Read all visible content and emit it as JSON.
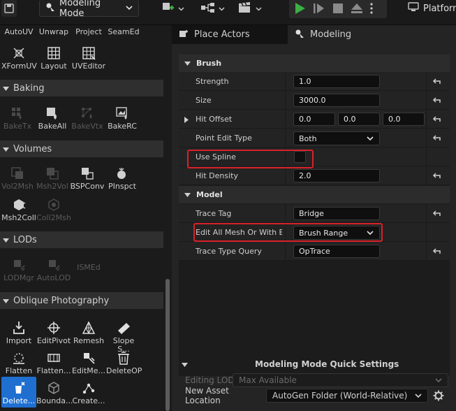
{
  "toolbar": {
    "mode_label": "Modeling Mode",
    "platform_label": "Platforms",
    "colors": {
      "play": "#3cb043",
      "bg": "#1a1a1a"
    }
  },
  "palette": {
    "top_tools": [
      {
        "label": "AutoUV",
        "icon": "auto-uv-icon",
        "enabled": true
      },
      {
        "label": "Unwrap",
        "icon": "unwrap-icon",
        "enabled": true
      },
      {
        "label": "Project",
        "icon": "project-icon",
        "enabled": true
      },
      {
        "label": "SeamEd",
        "icon": "seam-edit-icon",
        "enabled": true
      },
      {
        "label": "XFormUV",
        "icon": "transform-uv-icon",
        "enabled": true
      },
      {
        "label": "Layout",
        "icon": "layout-icon",
        "enabled": true
      },
      {
        "label": "UVEditor",
        "icon": "uv-editor-icon",
        "enabled": true
      }
    ],
    "sections": [
      {
        "title": "Baking",
        "tools": [
          {
            "label": "BakeTx",
            "enabled": false
          },
          {
            "label": "BakeAll",
            "enabled": true
          },
          {
            "label": "BakeVtx",
            "enabled": false
          },
          {
            "label": "BakeRC",
            "enabled": true
          }
        ]
      },
      {
        "title": "Volumes",
        "tools": [
          {
            "label": "Vol2Msh",
            "enabled": false
          },
          {
            "label": "Msh2Vol",
            "enabled": false
          },
          {
            "label": "BSPConv",
            "enabled": true
          },
          {
            "label": "PInspct",
            "enabled": true
          },
          {
            "label": "Msh2Coll",
            "enabled": true
          },
          {
            "label": "Coll2Msh",
            "enabled": false
          }
        ]
      },
      {
        "title": "LODs",
        "tools": [
          {
            "label": "LODMgr",
            "enabled": false
          },
          {
            "label": "AutoLOD",
            "enabled": false
          },
          {
            "label": "ISMEd",
            "enabled": false
          }
        ]
      },
      {
        "title": "Oblique Photography",
        "tools": [
          {
            "label": "Import",
            "enabled": true
          },
          {
            "label": "EditPivot",
            "enabled": true
          },
          {
            "label": "Remesh",
            "enabled": true
          },
          {
            "label": "Slope S...",
            "enabled": true
          },
          {
            "label": "Flatten",
            "enabled": true
          },
          {
            "label": "Flatten...",
            "enabled": true
          },
          {
            "label": "EditMe...",
            "enabled": true
          },
          {
            "label": "DeleteOP",
            "enabled": true
          },
          {
            "label": "Delete...",
            "enabled": true,
            "selected": true
          },
          {
            "label": "Bounda...",
            "enabled": true
          },
          {
            "label": "Create...",
            "enabled": true
          }
        ]
      }
    ]
  },
  "tabs": [
    {
      "label": "Place Actors",
      "active": false
    },
    {
      "label": "Modeling",
      "active": true
    }
  ],
  "details": {
    "brush_category": "Brush",
    "brush_props": {
      "strength_label": "Strength",
      "strength_value": "1.0",
      "size_label": "Size",
      "size_value": "3000.0",
      "hit_offset_label": "Hit Offset",
      "hit_offset_x": "0.0",
      "hit_offset_y": "0.0",
      "hit_offset_z": "0.0",
      "point_edit_type_label": "Point Edit Type",
      "point_edit_type_value": "Both",
      "use_spline_label": "Use Spline",
      "use_spline_checked": false,
      "hit_density_label": "Hit Density",
      "hit_density_value": "2.0"
    },
    "model_category": "Model",
    "model_props": {
      "trace_tag_label": "Trace Tag",
      "trace_tag_value": "Bridge",
      "edit_all_label": "Edit All Mesh Or With B...",
      "edit_all_value": "Brush Range",
      "trace_type_label": "Trace Type Query",
      "trace_type_value": "OpTrace"
    }
  },
  "quick_settings": {
    "title": "Modeling Mode Quick Settings",
    "editing_lod_label": "Editing LOD",
    "editing_lod_value": "Max Available",
    "new_asset_label": "New Asset Location",
    "new_asset_value": "AutoGen Folder (World-Relative)"
  },
  "highlight_color": "#d9212a"
}
